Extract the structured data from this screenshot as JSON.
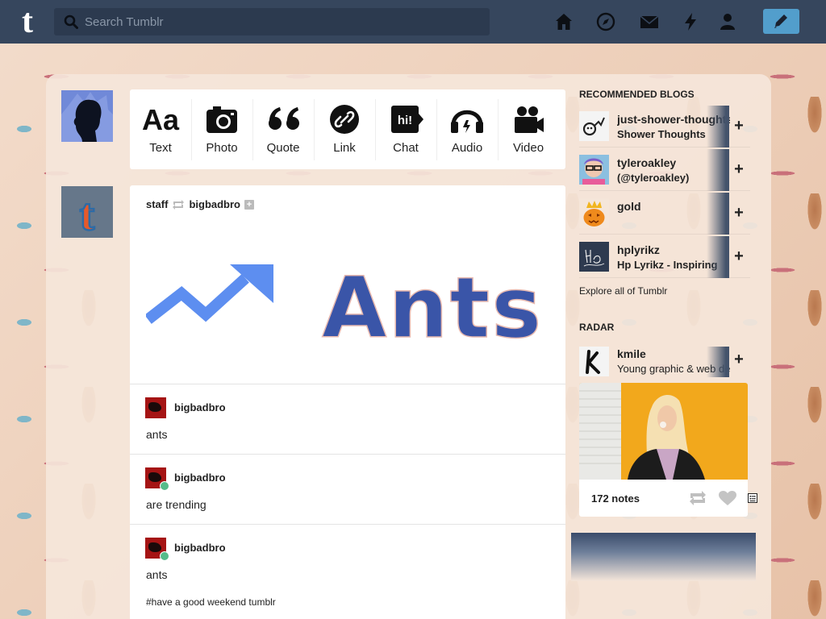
{
  "app": {
    "logo": "t",
    "search": {
      "placeholder": "Search Tumblr",
      "value": ""
    },
    "nav": [
      "home-icon",
      "explore-icon",
      "inbox-icon",
      "activity-icon",
      "account-icon"
    ],
    "compose": "compose-icon",
    "colors": {
      "topbar": "#36465d",
      "accent": "#529ecc",
      "reblog_green": "#56bc8a"
    }
  },
  "post_types": [
    {
      "label": "Text",
      "icon": "text-icon"
    },
    {
      "label": "Photo",
      "icon": "camera-icon"
    },
    {
      "label": "Quote",
      "icon": "quote-icon"
    },
    {
      "label": "Link",
      "icon": "link-icon"
    },
    {
      "label": "Chat",
      "icon": "chat-icon"
    },
    {
      "label": "Audio",
      "icon": "headphones-icon"
    },
    {
      "label": "Video",
      "icon": "video-icon"
    }
  ],
  "post": {
    "author": "staff",
    "reblogged_from": "bigbadbro",
    "image_text": "Ants",
    "reblogs": [
      {
        "user": "bigbadbro",
        "text": "ants"
      },
      {
        "user": "bigbadbro",
        "text": "are trending"
      },
      {
        "user": "bigbadbro",
        "text": "ants"
      }
    ],
    "tags": "#have a good weekend tumblr"
  },
  "sidebar": {
    "recommended_title": "RECOMMENDED BLOGS",
    "blogs": [
      {
        "name": "just-shower-thoughts",
        "subtitle": "Shower Thoughts"
      },
      {
        "name": "tyleroakley",
        "subtitle": "(@tyleroakley)"
      },
      {
        "name": "gold",
        "subtitle": ""
      },
      {
        "name": "hplyrikz",
        "subtitle": "Hp Lyrikz - Inspiring"
      }
    ],
    "follow_label": "+",
    "explore_label": "Explore all of Tumblr",
    "radar_title": "RADAR",
    "radar": {
      "name": "kmile",
      "subtitle": "Young graphic & web designer",
      "notes": "172 notes"
    }
  }
}
